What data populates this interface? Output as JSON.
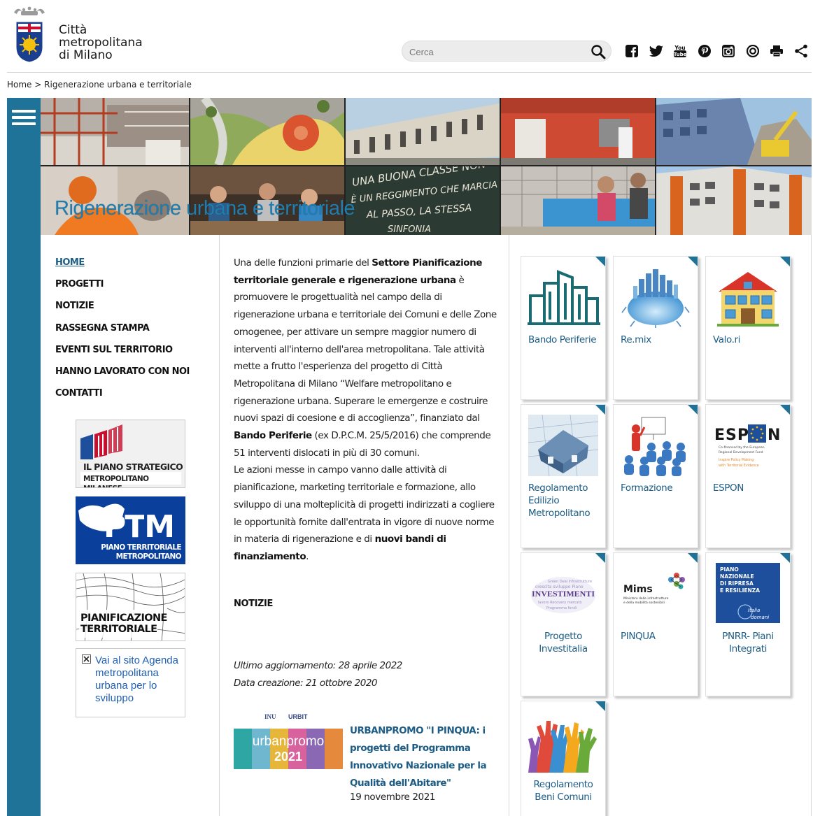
{
  "header": {
    "logo_line1": "Città",
    "logo_line2": "metropolitana",
    "logo_line3": "di Milano",
    "search_placeholder": "Cerca"
  },
  "breadcrumb": {
    "home": "Home",
    "separator": ">",
    "current": "Rigenerazione urbana e territoriale"
  },
  "banner": {
    "title": "Rigenerazione urbana e territoriale",
    "chalk_lines": [
      "UNA BUONA CLASSE NON",
      "È UN REGGIMENTO CHE MARCIA",
      "AL PASSO, LA STESSA",
      "SINFONIA"
    ]
  },
  "nav": {
    "items": [
      {
        "label": "HOME",
        "active": true
      },
      {
        "label": "PROGETTI"
      },
      {
        "label": "NOTIZIE"
      },
      {
        "label": "RASSEGNA STAMPA"
      },
      {
        "label": "EVENTI SUL TERRITORIO"
      },
      {
        "label": "HANNO LAVORATO CON NOI"
      },
      {
        "label": "CONTATTI"
      }
    ]
  },
  "promos": {
    "strategic_line1": "IL PIANO STRATEGICO",
    "strategic_line2": "METROPOLITANO MILANESE",
    "ptm_line1": "PIANO TERRITORIALE",
    "ptm_line2": "METROPOLITANO",
    "pian_line1": "PIANIFICAZIONE",
    "pian_line2": "TERRITORIALE",
    "agenda_link": "Vai al sito Agenda metropolitana urbana per lo sviluppo"
  },
  "content": {
    "p_intro": "Una delle funzioni primarie del ",
    "p_bold1": "Settore Pianificazione territoriale generale e rigenerazione urbana",
    "p_mid1": " è promuovere le progettualità nel campo della di rigenerazione urbana e territoriale dei Comuni e delle Zone omogenee, per attivare un sempre maggior numero di interventi all'interno dell'area metropolitana. Tale attività mette a frutto l'esperienza del progetto di Città Metropolitana di Milano “Welfare metropolitano e rigenerazione urbana. Superare le emergenze e costruire nuovi spazi di coesione e di accoglienza”, finanziato dal ",
    "p_bold2": "Bando Periferie",
    "p_mid2": " (ex D.P.C.M. 25/5/2016) che comprende 51 interventi dislocati in più di 30 comuni.",
    "p2_intro": "Le azioni messe in campo vanno dalle attività di pianificazione, marketing territoriale e formazione, allo sviluppo di una molteplicità di progetti indirizzati a cogliere le opportunità fornite dall'entrata in vigore di nuove norme in materia di rigenerazione e di ",
    "p2_bold": "nuovi bandi di finanziamento",
    "p2_end": ".",
    "notizie_heading": "NOTIZIE",
    "updated": "Ultimo aggiornamento: 28 aprile 2022",
    "created": "Data creazione: 21 ottobre 2020",
    "news": {
      "logo_inu": "INU",
      "logo_urbit": "URBIT",
      "thumb_word": "urbanpromo",
      "thumb_year": "2021",
      "title": "URBANPROMO \"I PINQUA: i progetti del Programma Innovativo Nazionale per la Qualità dell'Abitare\"",
      "date": "19 novembre 2021"
    }
  },
  "cards": [
    {
      "label": "Bando Periferie",
      "icon": "city-skyline-icon"
    },
    {
      "label": "Re.mix",
      "icon": "globe-city-icon"
    },
    {
      "label": "Valo.ri",
      "icon": "school-building-icon"
    },
    {
      "label": "Regolamento Edilizio Metropolitano",
      "icon": "house-blueprint-icon"
    },
    {
      "label": "Formazione",
      "icon": "training-class-icon"
    },
    {
      "label": "ESPON",
      "icon": "espon-logo-icon",
      "logo_text_left": "ESP",
      "logo_text_right": "N",
      "logo_sub1": "Co-financed by the European",
      "logo_sub2": "Regional Development Fund",
      "logo_sub3": "Inspire Policy Making",
      "logo_sub4": "with Territorial Evidence"
    },
    {
      "label": "Progetto Investitalia",
      "icon": "investimenti-wordcloud-icon",
      "img_word": "INVESTIMENTI"
    },
    {
      "label": "PINQUA",
      "icon": "mims-logo-icon",
      "img_word": "Mims",
      "img_sub1": "Ministero delle infrastrutture",
      "img_sub2": "e della mobilità sostenibili"
    },
    {
      "label": "PNRR- Piani Integrati",
      "icon": "pnrr-logo-icon",
      "img_line1": "PIANO",
      "img_line2": "NAZIONALE",
      "img_line3": "DI RIPRESA",
      "img_line4": "E RESILIENZA",
      "img_line5": "Italia",
      "img_line6": "domani"
    },
    {
      "label": "Regolamento Beni Comuni",
      "icon": "raised-hands-icon"
    }
  ],
  "colors": {
    "accent": "#1f7399",
    "link": "#1d5c85",
    "banner_title": "#1f7db0"
  }
}
